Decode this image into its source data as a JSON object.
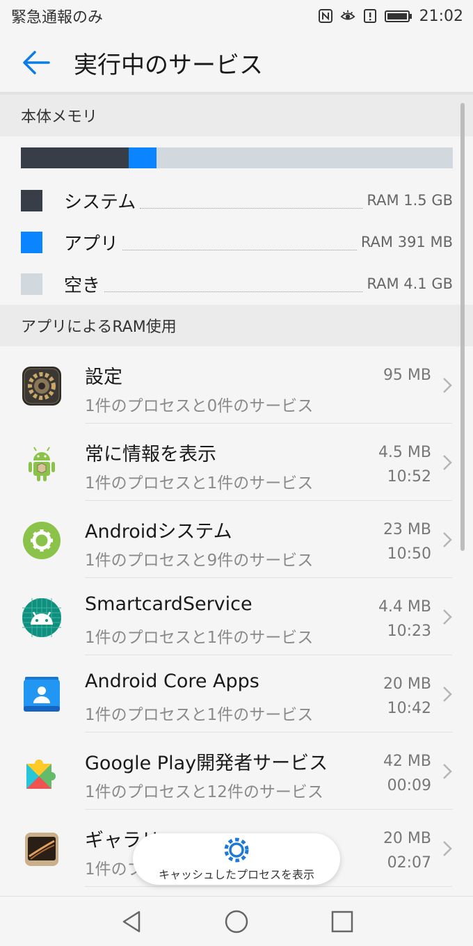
{
  "status_bar": {
    "left_text": "緊急通報のみ",
    "time": "21:02"
  },
  "app_bar": {
    "title": "実行中のサービス"
  },
  "memory": {
    "section_title": "本体メモリ",
    "legend": [
      {
        "label": "システム",
        "value": "RAM 1.5 GB",
        "color": "#373e47",
        "fraction": 0.25
      },
      {
        "label": "アプリ",
        "value": "RAM 391 MB",
        "color": "#0a84ff",
        "fraction": 0.064
      },
      {
        "label": "空き",
        "value": "RAM 4.1 GB",
        "color": "#d1d9df",
        "fraction": 0.686
      }
    ]
  },
  "apps_section": {
    "title": "アプリによるRAM使用"
  },
  "apps": [
    {
      "name": "設定",
      "sub": "1件のプロセスと0件のサービス",
      "size": "95 MB",
      "time": "",
      "icon": "settings-app-icon"
    },
    {
      "name": "常に情報を表示",
      "sub": "1件のプロセスと1件のサービス",
      "size": "4.5 MB",
      "time": "10:52",
      "icon": "android-robot-icon"
    },
    {
      "name": "Androidシステム",
      "sub": "1件のプロセスと9件のサービス",
      "size": "23 MB",
      "time": "10:50",
      "icon": "android-system-gear-icon"
    },
    {
      "name": "SmartcardService",
      "sub": "1件のプロセスと1件のサービス",
      "size": "4.4 MB",
      "time": "10:23",
      "icon": "android-head-icon"
    },
    {
      "name": "Android Core Apps",
      "sub": "1件のプロセスと1件のサービス",
      "size": "20 MB",
      "time": "10:42",
      "icon": "contacts-card-icon"
    },
    {
      "name": "Google Play開発者サービス",
      "sub": "1件のプロセスと12件のサービス",
      "size": "42 MB",
      "time": "00:09",
      "icon": "puzzle-piece-icon"
    },
    {
      "name": "ギャラリー",
      "sub": "1件のプロセスと2件のサービス",
      "size": "20 MB",
      "time": "02:07",
      "icon": "gallery-photo-icon"
    }
  ],
  "fab": {
    "label": "キャッシュしたプロセスを表示"
  }
}
